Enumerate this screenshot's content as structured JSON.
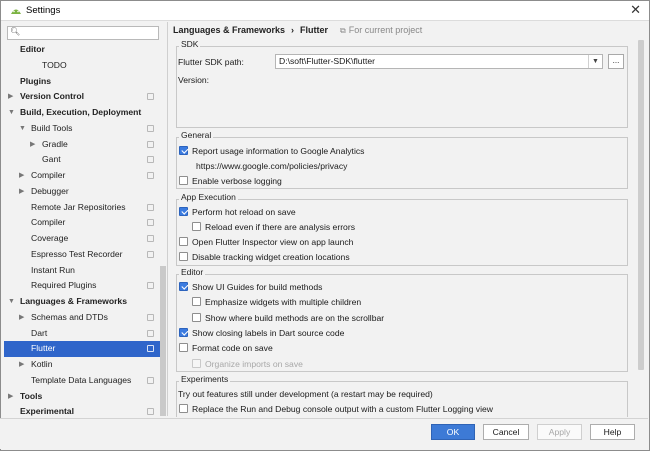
{
  "window": {
    "title": "Settings"
  },
  "search": {
    "placeholder": ""
  },
  "sidebar": {
    "items": [
      {
        "label": "Editor",
        "bold": true,
        "arrow": "",
        "indent": 0,
        "cfg": false
      },
      {
        "label": "TODO",
        "bold": false,
        "arrow": "",
        "indent": 2,
        "cfg": false
      },
      {
        "label": "Plugins",
        "bold": true,
        "arrow": "",
        "indent": 0,
        "cfg": false
      },
      {
        "label": "Version Control",
        "bold": true,
        "arrow": "▶",
        "indent": 0,
        "cfg": true
      },
      {
        "label": "Build, Execution, Deployment",
        "bold": true,
        "arrow": "▼",
        "indent": 0,
        "cfg": false
      },
      {
        "label": "Build Tools",
        "bold": false,
        "arrow": "▼",
        "indent": 1,
        "cfg": true
      },
      {
        "label": "Gradle",
        "bold": false,
        "arrow": "▶",
        "indent": 2,
        "cfg": true
      },
      {
        "label": "Gant",
        "bold": false,
        "arrow": "",
        "indent": 2,
        "cfg": true
      },
      {
        "label": "Compiler",
        "bold": false,
        "arrow": "▶",
        "indent": 1,
        "cfg": true
      },
      {
        "label": "Debugger",
        "bold": false,
        "arrow": "▶",
        "indent": 1,
        "cfg": false
      },
      {
        "label": "Remote Jar Repositories",
        "bold": false,
        "arrow": "",
        "indent": 1,
        "cfg": true
      },
      {
        "label": "Compiler",
        "bold": false,
        "arrow": "",
        "indent": 1,
        "cfg": true
      },
      {
        "label": "Coverage",
        "bold": false,
        "arrow": "",
        "indent": 1,
        "cfg": true
      },
      {
        "label": "Espresso Test Recorder",
        "bold": false,
        "arrow": "",
        "indent": 1,
        "cfg": true
      },
      {
        "label": "Instant Run",
        "bold": false,
        "arrow": "",
        "indent": 1,
        "cfg": false
      },
      {
        "label": "Required Plugins",
        "bold": false,
        "arrow": "",
        "indent": 1,
        "cfg": true
      },
      {
        "label": "Languages & Frameworks",
        "bold": true,
        "arrow": "▼",
        "indent": 0,
        "cfg": false
      },
      {
        "label": "Schemas and DTDs",
        "bold": false,
        "arrow": "▶",
        "indent": 1,
        "cfg": true
      },
      {
        "label": "Dart",
        "bold": false,
        "arrow": "",
        "indent": 1,
        "cfg": true
      },
      {
        "label": "Flutter",
        "bold": false,
        "arrow": "",
        "indent": 1,
        "cfg": true,
        "selected": true
      },
      {
        "label": "Kotlin",
        "bold": false,
        "arrow": "▶",
        "indent": 1,
        "cfg": false
      },
      {
        "label": "Template Data Languages",
        "bold": false,
        "arrow": "",
        "indent": 1,
        "cfg": true
      },
      {
        "label": "Tools",
        "bold": true,
        "arrow": "▶",
        "indent": 0,
        "cfg": false
      },
      {
        "label": "Experimental",
        "bold": true,
        "arrow": "",
        "indent": 0,
        "cfg": true
      }
    ]
  },
  "breadcrumb": {
    "parent": "Languages & Frameworks",
    "separator": "›",
    "current": "Flutter",
    "project_note": "For current project"
  },
  "sdk": {
    "group_title": "SDK",
    "path_label": "Flutter SDK path:",
    "path_value": "D:\\soft\\Flutter-SDK\\flutter",
    "browse_label": "...",
    "version_label": "Version:"
  },
  "general": {
    "group_title": "General",
    "report_usage": "Report usage information to Google Analytics",
    "privacy_url": "https://www.google.com/policies/privacy",
    "verbose_logging": "Enable verbose logging"
  },
  "app_execution": {
    "group_title": "App Execution",
    "hot_reload": "Perform hot reload on save",
    "reload_errors": "Reload even if there are analysis errors",
    "open_inspector": "Open Flutter Inspector view on app launch",
    "disable_tracking": "Disable tracking widget creation locations"
  },
  "editor": {
    "group_title": "Editor",
    "ui_guides": "Show UI Guides for build methods",
    "emphasize_widgets": "Emphasize widgets with multiple children",
    "show_where": "Show where build methods are on the scrollbar",
    "closing_labels": "Show closing labels in Dart source code",
    "format_on_save": "Format code on save",
    "organize_imports": "Organize imports on save"
  },
  "experiments": {
    "group_title": "Experiments",
    "description": "Try out features still under development (a restart may be required)",
    "replace_console": "Replace the Run and Debug console output with a custom Flutter Logging view"
  },
  "footer": {
    "ok": "OK",
    "cancel": "Cancel",
    "apply": "Apply",
    "help": "Help"
  },
  "colors": {
    "selection": "#2f65ca",
    "ok_button": "#3d7ad6",
    "checkbox_checked": "#3b7be0"
  }
}
